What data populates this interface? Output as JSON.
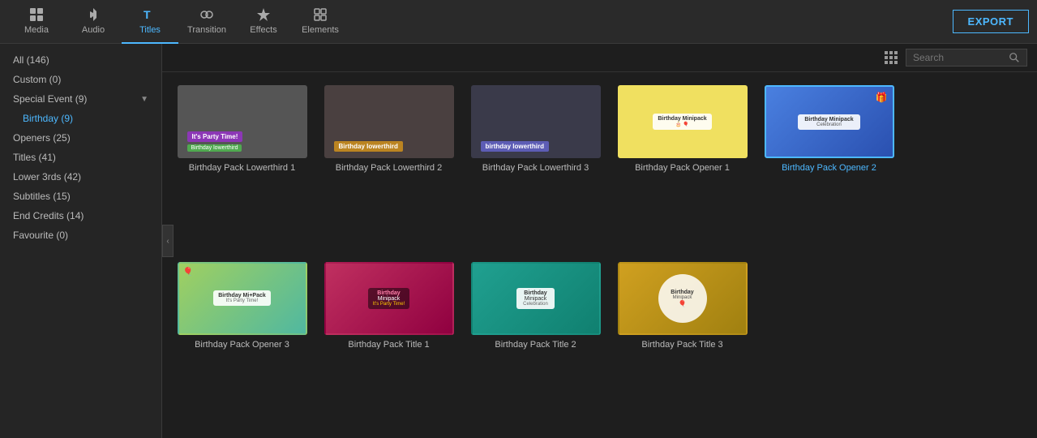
{
  "toolbar": {
    "export_label": "EXPORT",
    "items": [
      {
        "id": "media",
        "label": "Media",
        "active": false
      },
      {
        "id": "audio",
        "label": "Audio",
        "active": false
      },
      {
        "id": "titles",
        "label": "Titles",
        "active": true
      },
      {
        "id": "transition",
        "label": "Transition",
        "active": false
      },
      {
        "id": "effects",
        "label": "Effects",
        "active": false
      },
      {
        "id": "elements",
        "label": "Elements",
        "active": false
      }
    ]
  },
  "sidebar": {
    "items": [
      {
        "id": "all",
        "label": "All (146)",
        "active": false,
        "indent": 0,
        "chevron": false
      },
      {
        "id": "custom",
        "label": "Custom (0)",
        "active": false,
        "indent": 0,
        "chevron": false
      },
      {
        "id": "special-event",
        "label": "Special Event (9)",
        "active": false,
        "indent": 0,
        "chevron": true
      },
      {
        "id": "birthday",
        "label": "Birthday (9)",
        "active": true,
        "indent": 1,
        "chevron": false
      },
      {
        "id": "openers",
        "label": "Openers (25)",
        "active": false,
        "indent": 0,
        "chevron": false
      },
      {
        "id": "titles",
        "label": "Titles (41)",
        "active": false,
        "indent": 0,
        "chevron": false
      },
      {
        "id": "lower3rds",
        "label": "Lower 3rds (42)",
        "active": false,
        "indent": 0,
        "chevron": false
      },
      {
        "id": "subtitles",
        "label": "Subtitles (15)",
        "active": false,
        "indent": 0,
        "chevron": false
      },
      {
        "id": "endcredits",
        "label": "End Credits (14)",
        "active": false,
        "indent": 0,
        "chevron": false
      },
      {
        "id": "favourite",
        "label": "Favourite (0)",
        "active": false,
        "indent": 0,
        "chevron": false
      }
    ]
  },
  "search": {
    "placeholder": "Search"
  },
  "grid": {
    "items": [
      {
        "id": "lt1",
        "label": "Birthday Pack Lowerthird 1",
        "bg": "dark-photo",
        "selected": false,
        "badge": "Birthday lowerthird"
      },
      {
        "id": "lt2",
        "label": "Birthday Pack Lowerthird 2",
        "bg": "dark-photo",
        "selected": false,
        "badge": "Birthday lowerthird"
      },
      {
        "id": "lt3",
        "label": "Birthday Pack Lowerthird 3",
        "bg": "dark-photo",
        "selected": false,
        "badge": "birthday lowerthird"
      },
      {
        "id": "op1",
        "label": "Birthday Pack Opener 1",
        "bg": "birthday-yellow",
        "selected": false,
        "badge": "Birthday Minipack"
      },
      {
        "id": "op2",
        "label": "Birthday Pack Opener 2",
        "bg": "birthday-blue",
        "selected": true,
        "badge": "Birthday Minipack Celebration"
      },
      {
        "id": "op3",
        "label": "Birthday Pack Opener 3",
        "bg": "birthday-colorful",
        "selected": false,
        "badge": "Birthday Mi+Pack"
      },
      {
        "id": "title1",
        "label": "Birthday Pack Title 1",
        "bg": "birthday-pink",
        "selected": false,
        "badge": "Birthday Minipack"
      },
      {
        "id": "title2",
        "label": "Birthday Pack Title 2",
        "bg": "birthday-teal",
        "selected": false,
        "badge": "Birthday Minipack Celebration"
      },
      {
        "id": "title3",
        "label": "Birthday Pack Title 3",
        "bg": "birthday-orange",
        "selected": false,
        "badge": "Birthday Minipack"
      }
    ]
  }
}
